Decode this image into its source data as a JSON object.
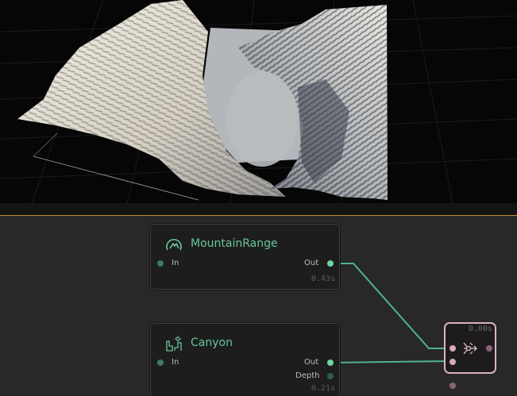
{
  "viewport": {
    "description_icon": "terrain-3d-preview"
  },
  "nodes": {
    "mountain_range": {
      "title": "MountainRange",
      "icon": "mountain-icon",
      "input_label": "In",
      "output_label": "Out",
      "timing": "0.43s"
    },
    "canyon": {
      "title": "Canyon",
      "icon": "canyon-icon",
      "input_label": "In",
      "output_label": "Out",
      "extra_output_label": "Depth",
      "timing": "0.21s"
    },
    "combine": {
      "icon": "combine-icon",
      "timing": "0.00s"
    }
  },
  "colors": {
    "accent_green": "#66c79a",
    "divider_gold": "#b8912c",
    "combine_pink": "#d9b3c6"
  }
}
